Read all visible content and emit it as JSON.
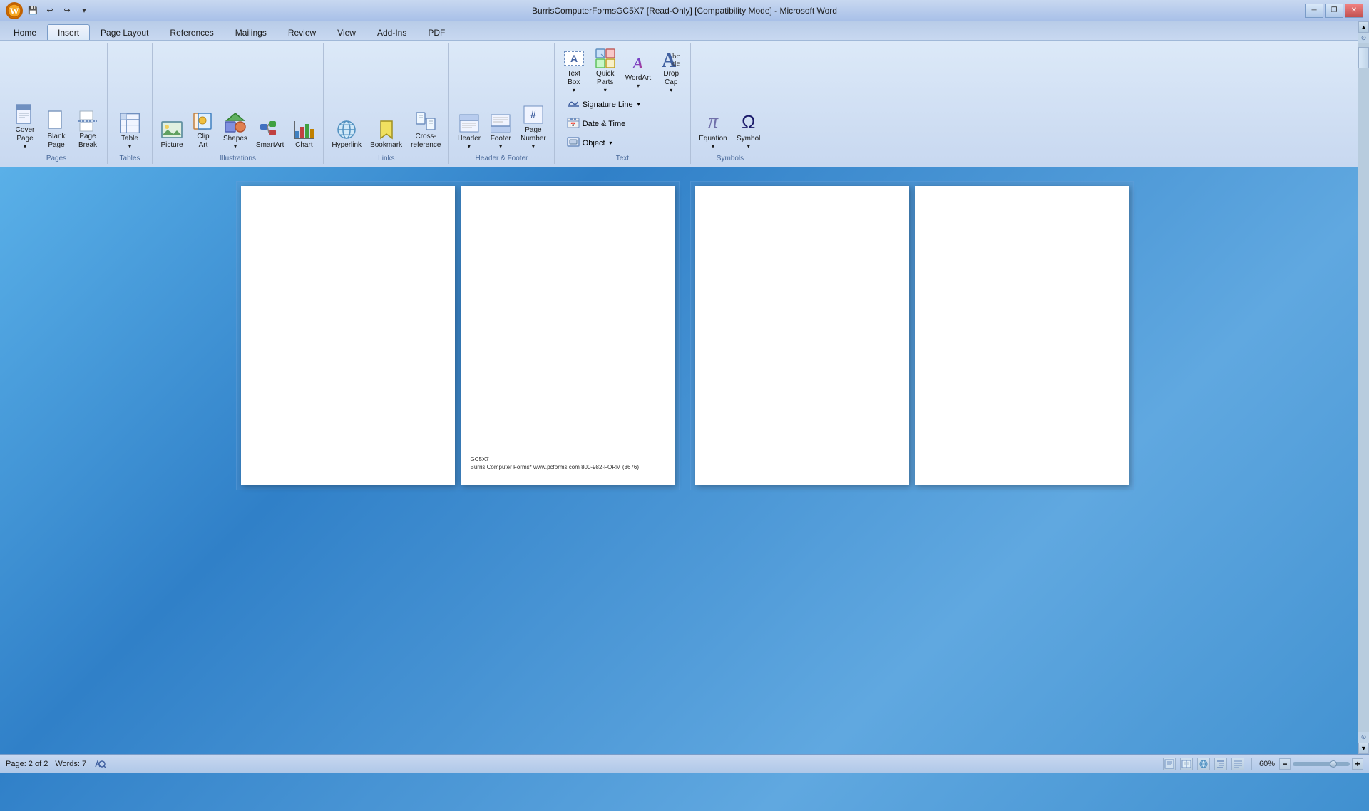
{
  "titlebar": {
    "logo": "W",
    "title": "BurrisComputerFormsGC5X7 [Read-Only] [Compatibility Mode] - Microsoft Word",
    "quickaccess": [
      "save",
      "undo",
      "redo",
      "customize"
    ],
    "winbtns": [
      "minimize",
      "restore",
      "close"
    ]
  },
  "ribbon": {
    "tabs": [
      "Home",
      "Insert",
      "Page Layout",
      "References",
      "Mailings",
      "Review",
      "View",
      "Add-Ins",
      "PDF"
    ],
    "active_tab": "Insert",
    "groups": {
      "pages": {
        "label": "Pages",
        "buttons": [
          {
            "id": "cover-page",
            "label": "Cover\nPage",
            "icon": "📄"
          },
          {
            "id": "blank-page",
            "label": "Blank\nPage",
            "icon": "📃"
          },
          {
            "id": "page-break",
            "label": "Page\nBreak",
            "icon": "📑"
          }
        ]
      },
      "tables": {
        "label": "Tables",
        "buttons": [
          {
            "id": "table",
            "label": "Table",
            "icon": "⊞"
          }
        ]
      },
      "illustrations": {
        "label": "Illustrations",
        "buttons": [
          {
            "id": "picture",
            "label": "Picture",
            "icon": "🖼"
          },
          {
            "id": "clip-art",
            "label": "Clip\nArt",
            "icon": "✂"
          },
          {
            "id": "shapes",
            "label": "Shapes",
            "icon": "◻"
          },
          {
            "id": "smartart",
            "label": "SmartArt",
            "icon": "📊"
          },
          {
            "id": "chart",
            "label": "Chart",
            "icon": "📈"
          }
        ]
      },
      "links": {
        "label": "Links",
        "buttons": [
          {
            "id": "hyperlink",
            "label": "Hyperlink",
            "icon": "🔗"
          },
          {
            "id": "bookmark",
            "label": "Bookmark",
            "icon": "🔖"
          },
          {
            "id": "cross-reference",
            "label": "Cross-\nreference",
            "icon": "📎"
          }
        ]
      },
      "header_footer": {
        "label": "Header & Footer",
        "buttons": [
          {
            "id": "header",
            "label": "Header",
            "icon": "▭"
          },
          {
            "id": "footer",
            "label": "Footer",
            "icon": "▬"
          },
          {
            "id": "page-number",
            "label": "Page\nNumber",
            "icon": "#"
          }
        ]
      },
      "text": {
        "label": "Text",
        "buttons": [
          {
            "id": "text-box",
            "label": "Text\nBox",
            "icon": "📝"
          },
          {
            "id": "quick-parts",
            "label": "Quick\nParts",
            "icon": "⚡"
          },
          {
            "id": "wordart",
            "label": "WordArt",
            "icon": "A"
          },
          {
            "id": "drop-cap",
            "label": "Drop\nCap",
            "icon": "A"
          },
          {
            "id": "signature-line",
            "label": "Signature Line",
            "icon": "✍"
          },
          {
            "id": "date-time",
            "label": "Date & Time",
            "icon": "📅"
          },
          {
            "id": "object",
            "label": "Object",
            "icon": "⬜"
          }
        ]
      },
      "symbols": {
        "label": "Symbols",
        "buttons": [
          {
            "id": "equation",
            "label": "Equation",
            "icon": "π"
          },
          {
            "id": "symbol",
            "label": "Symbol",
            "icon": "Ω"
          }
        ]
      }
    }
  },
  "document": {
    "pages": [
      {
        "id": "page1-left",
        "empty": true,
        "footer": ""
      },
      {
        "id": "page1-right",
        "empty": false,
        "footer_line1": "GC5X7",
        "footer_line2": "Burris Computer Forms* www.pcforms.com  800-982-FORM (3676)"
      },
      {
        "id": "page2-left",
        "empty": true,
        "footer": ""
      },
      {
        "id": "page2-right",
        "empty": true,
        "footer": ""
      }
    ]
  },
  "statusbar": {
    "page": "Page: 2 of 2",
    "words": "Words: 7",
    "zoom": "60%",
    "views": [
      "print-layout",
      "full-reading",
      "web-layout",
      "outline",
      "draft"
    ]
  }
}
